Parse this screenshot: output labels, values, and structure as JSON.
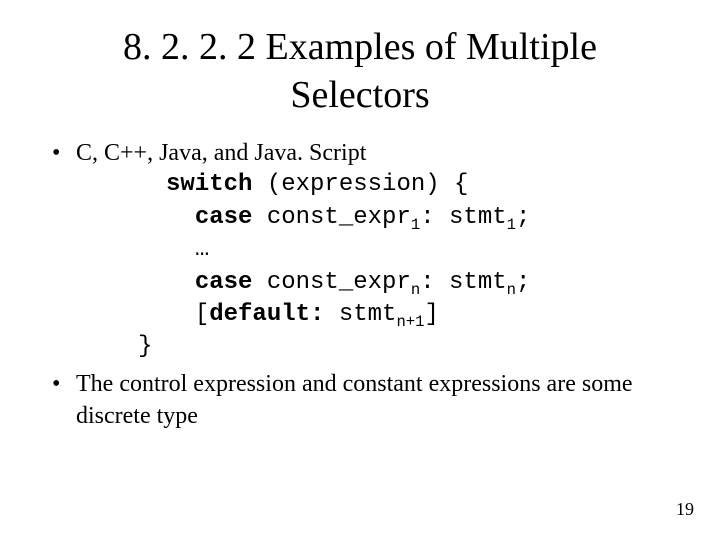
{
  "title_line1": "8. 2. 2. 2 Examples of Multiple",
  "title_line2": "Selectors",
  "bullet1": "C, C++, Java, and Java. Script",
  "code": {
    "kw_switch": "switch",
    "switch_rest": " (expression) {",
    "kw_case1": "case",
    "case1_expr": " const_expr",
    "case1_sub": "1",
    "case1_colon": ":",
    "case1_stmt": " stmt",
    "case1_stmt_sub": "1",
    "case1_semi": ";",
    "ellipsis": "…",
    "kw_case_n": "case",
    "casen_expr": " const_expr",
    "casen_sub": "n",
    "casen_colon": ":",
    "casen_stmt": " stmt",
    "casen_stmt_sub": "n",
    "casen_semi": ";",
    "default_open": "[",
    "kw_default": "default:",
    "default_stmt": " stmt",
    "default_sub": "n+1",
    "default_close": "]",
    "close_brace": "}"
  },
  "bullet2": "The control expression and constant expressions are some discrete type",
  "page_number": "19"
}
